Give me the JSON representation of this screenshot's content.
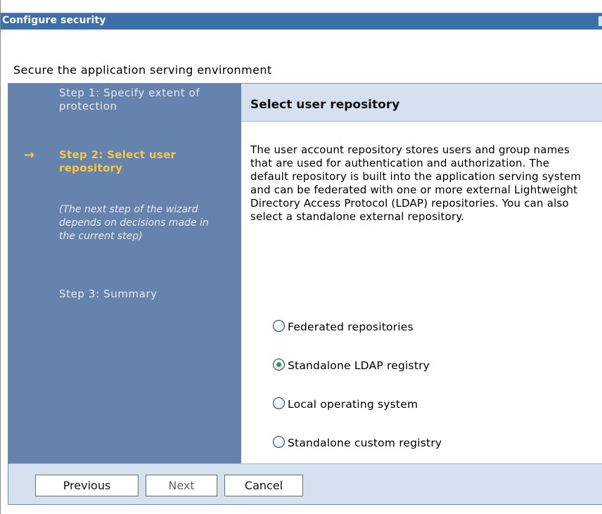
{
  "window": {
    "title": "Configure security"
  },
  "page": {
    "subtitle": "Secure the application serving environment"
  },
  "steps": {
    "step1": "Step 1: Specify extent of protection",
    "step2": "Step 2: Select user repository",
    "note": "(The next step of the wizard depends on decisions made in the current step)",
    "step3": "Step 3: Summary"
  },
  "content": {
    "title": "Select user repository",
    "description": "The user account repository stores users and group names that are used for authentication and authorization. The default repository is built into the application serving system and can be federated with one or more external Lightweight Directory Access Protocol (LDAP) repositories. You can also select a standalone external repository.",
    "options": [
      {
        "label": "Federated repositories",
        "selected": false
      },
      {
        "label": "Standalone LDAP registry",
        "selected": true
      },
      {
        "label": "Local operating system",
        "selected": false
      },
      {
        "label": "Standalone custom registry",
        "selected": false
      }
    ]
  },
  "footer": {
    "previous_label": "Previous",
    "next_label": "Next",
    "cancel_label": "Cancel"
  }
}
